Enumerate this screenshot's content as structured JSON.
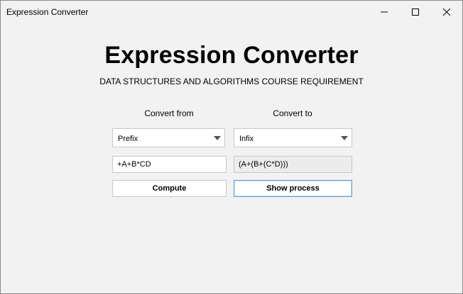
{
  "window": {
    "title": "Expression Converter"
  },
  "header": {
    "title": "Expression Converter",
    "subtitle": "DATA STRUCTURES AND ALGORITHMS COURSE REQUIREMENT"
  },
  "converter": {
    "from_label": "Convert from",
    "to_label": "Convert to",
    "from_selected": "Prefix",
    "to_selected": "Infix",
    "input_value": "+A+B*CD",
    "output_value": "(A+(B+(C*D)))",
    "compute_label": "Compute",
    "show_process_label": "Show process"
  },
  "icons": {
    "minimize": "minimize-icon",
    "maximize": "maximize-icon",
    "close": "close-icon",
    "dropdown": "chevron-down-icon"
  },
  "colors": {
    "window_bg": "#f2f2f2",
    "focus_border": "#5b9bd5",
    "output_bg": "#ececec"
  }
}
